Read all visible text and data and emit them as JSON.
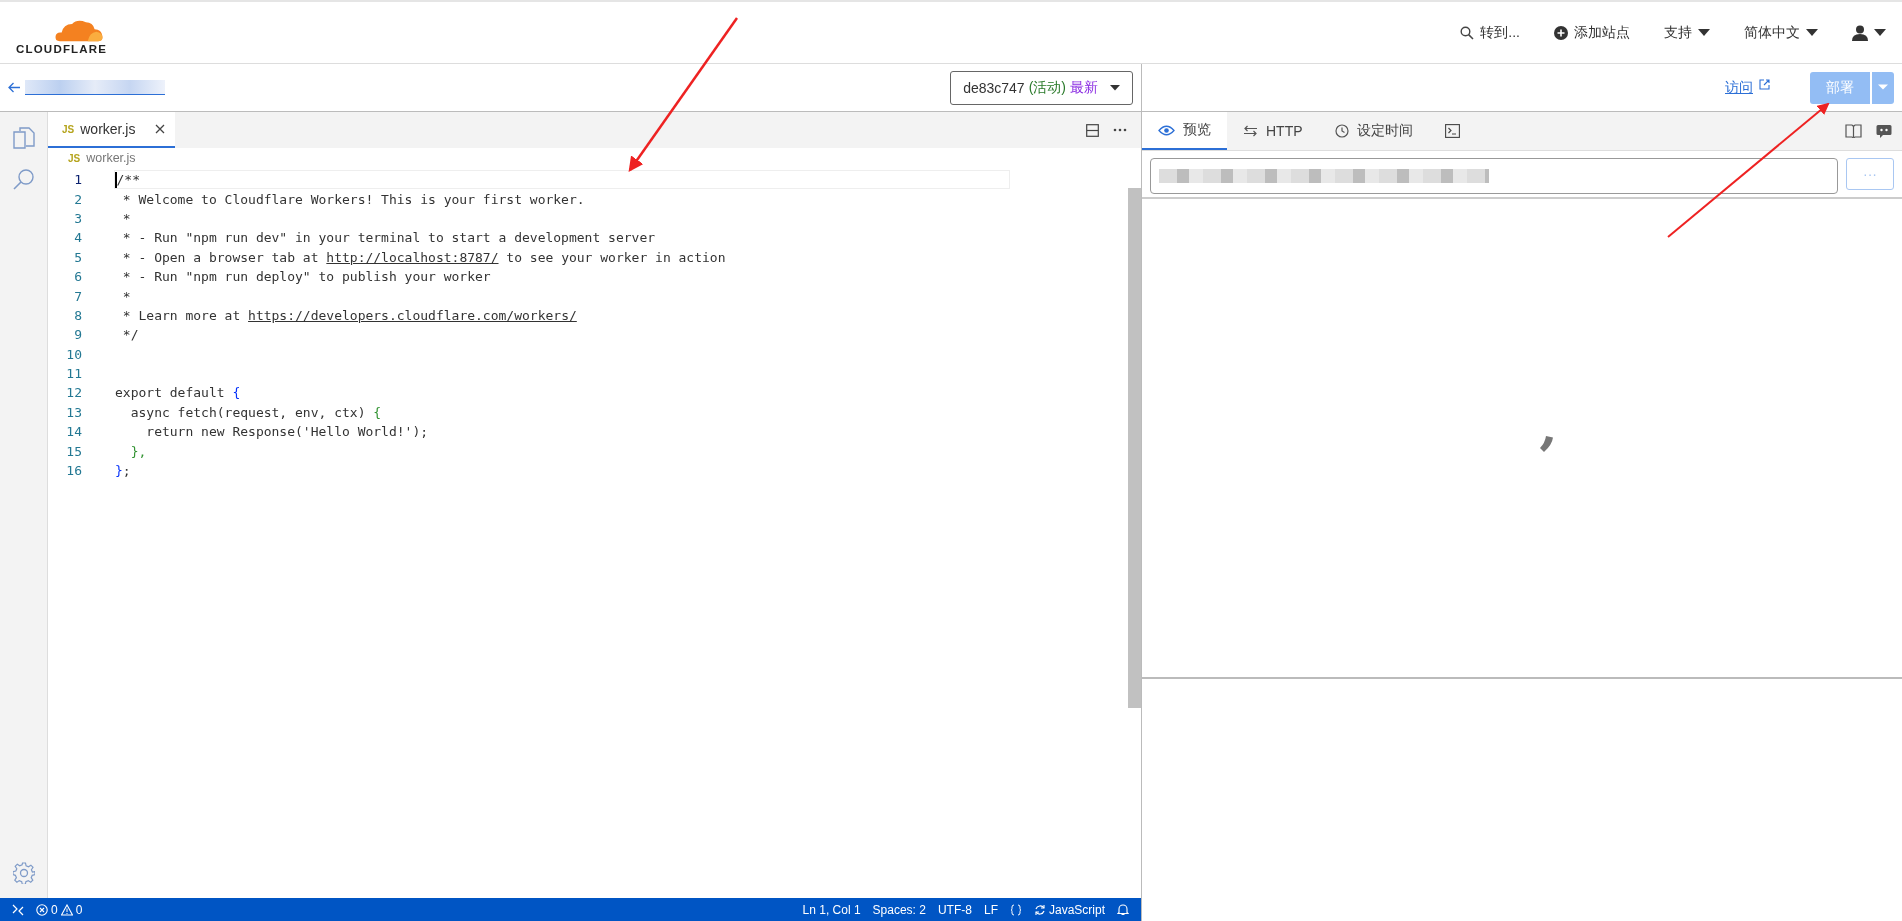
{
  "header": {
    "logo": "CLOUDFLARE",
    "nav": [
      {
        "label": "转到...",
        "kind": "search"
      },
      {
        "label": "添加站点",
        "kind": "add"
      },
      {
        "label": "支持",
        "kind": "menu"
      },
      {
        "label": "简体中文",
        "kind": "menu"
      }
    ]
  },
  "version": {
    "id": "de83c747",
    "status": "(活动)",
    "tag": "最新"
  },
  "visit_link": "访问",
  "deploy_button": {
    "label": "部署",
    "disabled": true
  },
  "editor_tabs": [
    {
      "badge": "JS",
      "label": "worker.js",
      "selected": true
    }
  ],
  "breadcrumb": {
    "badge": "JS",
    "label": "worker.js"
  },
  "code": [
    {
      "n": "1",
      "current": true,
      "tokens": [
        {
          "text": "/**",
          "kind": "comment"
        }
      ]
    },
    {
      "n": "2",
      "current": false,
      "tokens": [
        {
          "text": " * Welcome to Cloudflare Workers! This is your first worker.",
          "kind": "comment"
        }
      ]
    },
    {
      "n": "3",
      "current": false,
      "tokens": [
        {
          "text": " *",
          "kind": "comment"
        }
      ]
    },
    {
      "n": "4",
      "current": false,
      "tokens": [
        {
          "text": " * - Run \"npm run dev\" in your terminal to start a development server",
          "kind": "comment"
        }
      ]
    },
    {
      "n": "5",
      "current": false,
      "tokens": [
        {
          "text": " * - Open a browser tab at ",
          "kind": "comment"
        },
        {
          "text": "http://localhost:8787/",
          "kind": "link"
        },
        {
          "text": " to see your worker in action",
          "kind": "comment"
        }
      ]
    },
    {
      "n": "6",
      "current": false,
      "tokens": [
        {
          "text": " * - Run \"npm run deploy\" to publish your worker",
          "kind": "comment"
        }
      ]
    },
    {
      "n": "7",
      "current": false,
      "tokens": [
        {
          "text": " *",
          "kind": "comment"
        }
      ]
    },
    {
      "n": "8",
      "current": false,
      "tokens": [
        {
          "text": " * Learn more at ",
          "kind": "comment"
        },
        {
          "text": "https://developers.cloudflare.com/workers/",
          "kind": "link"
        }
      ]
    },
    {
      "n": "9",
      "current": false,
      "tokens": [
        {
          "text": " */",
          "kind": "comment"
        }
      ]
    },
    {
      "n": "10",
      "current": false
    },
    {
      "n": "11",
      "current": false
    },
    {
      "n": "12",
      "current": false,
      "tokens": [
        {
          "text": "export default ",
          "kind": "plain"
        },
        {
          "text": "{",
          "kind": "brace1"
        }
      ]
    },
    {
      "n": "13",
      "current": false,
      "tokens": [
        {
          "text": "  async fetch(request, env, ctx) ",
          "kind": "plain"
        },
        {
          "text": "{",
          "kind": "brace2"
        }
      ]
    },
    {
      "n": "14",
      "current": false,
      "tokens": [
        {
          "text": "    return new Response('Hello World!');",
          "kind": "plain"
        }
      ]
    },
    {
      "n": "15",
      "current": false,
      "tokens": [
        {
          "text": "  },",
          "kind": "brace2"
        }
      ]
    },
    {
      "n": "16",
      "current": false,
      "tokens": [
        {
          "text": "}",
          "kind": "brace1"
        },
        {
          "text": ";",
          "kind": "plain"
        }
      ]
    }
  ],
  "status_bar": {
    "errors": "0",
    "warnings": "0",
    "position": "Ln 1, Col 1",
    "indent": "Spaces: 2",
    "encoding": "UTF-8",
    "eol": "LF",
    "language": "JavaScript"
  },
  "preview_tabs": [
    {
      "label": "预览",
      "kind": "eye",
      "selected": true
    },
    {
      "label": "HTTP",
      "kind": "arrows",
      "selected": false
    },
    {
      "label": "设定时间",
      "kind": "clock",
      "selected": false
    },
    {
      "kind": "terminal",
      "selected": false
    }
  ],
  "more_button": "···"
}
